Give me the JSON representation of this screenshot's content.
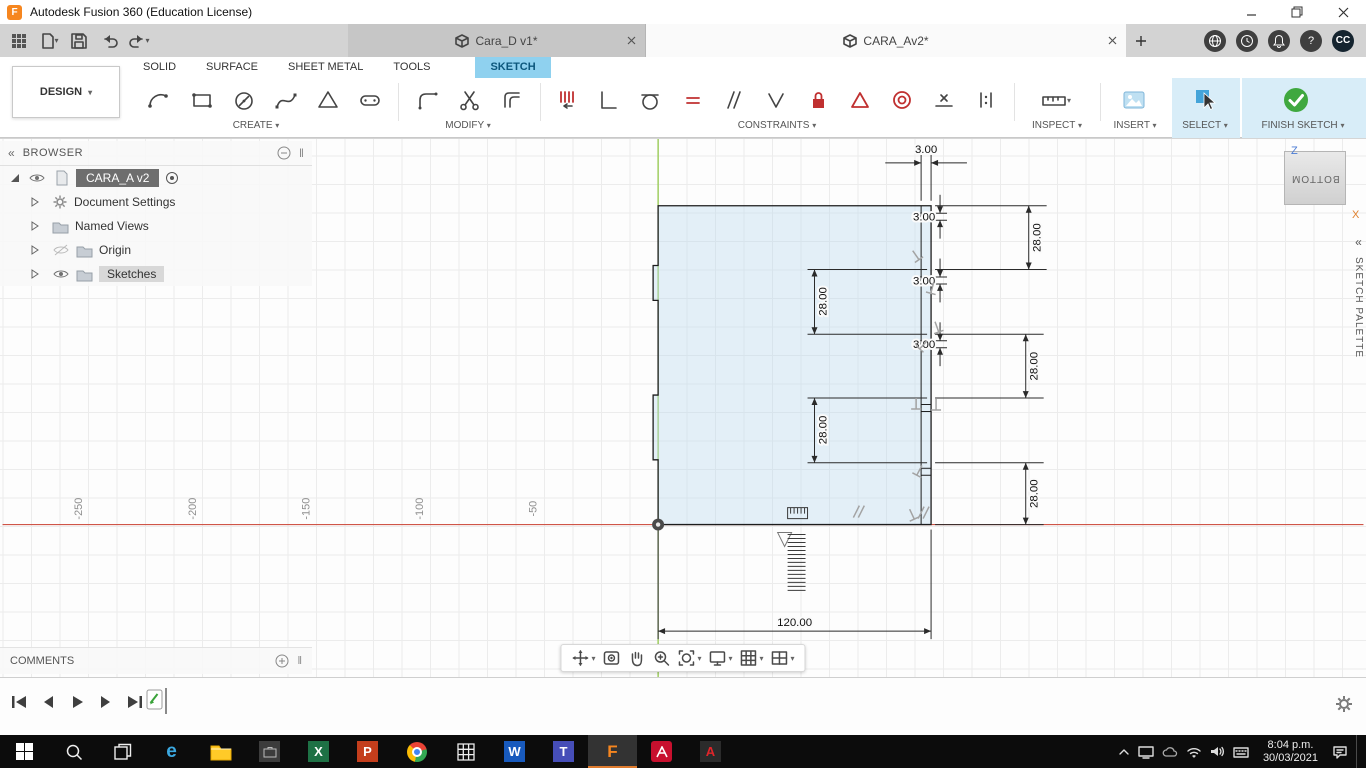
{
  "titlebar": {
    "title": "Autodesk Fusion 360 (Education License)"
  },
  "tabbar": {
    "doc_tabs": [
      {
        "label": "Cara_D v1*"
      },
      {
        "label": "CARA_Av2*"
      }
    ],
    "avatar": "CC"
  },
  "glyphs": {
    "fusion": "F",
    "help": "?",
    "edge": "e",
    "excel": "X",
    "powerpoint": "P",
    "word": "W",
    "teams": "T",
    "acrobat": "A"
  },
  "ribbon": {
    "design_label": "DESIGN",
    "tabs": [
      {
        "label": "SOLID"
      },
      {
        "label": "SURFACE"
      },
      {
        "label": "SHEET METAL"
      },
      {
        "label": "TOOLS"
      },
      {
        "label": "SKETCH"
      }
    ],
    "active_tab": "SKETCH",
    "groups": [
      {
        "label": "CREATE"
      },
      {
        "label": "MODIFY"
      },
      {
        "label": "CONSTRAINTS"
      },
      {
        "label": "INSPECT"
      },
      {
        "label": "INSERT"
      },
      {
        "label": "SELECT"
      },
      {
        "label": "FINISH SKETCH"
      }
    ]
  },
  "browser": {
    "header": "BROWSER",
    "root_label": "CARA_A v2",
    "items": [
      {
        "label": "Document Settings"
      },
      {
        "label": "Named Views"
      },
      {
        "label": "Origin"
      },
      {
        "label": "Sketches"
      }
    ]
  },
  "comments": {
    "label": "COMMENTS"
  },
  "sketch_palette": {
    "label": "SKETCH PALETTE"
  },
  "viewcube": {
    "face": "BOTTOM",
    "z": "Z",
    "x": "X"
  },
  "canvas": {
    "ruler_labels": [
      {
        "v": "-250"
      },
      {
        "v": "-200"
      },
      {
        "v": "-150"
      },
      {
        "v": "-100"
      },
      {
        "v": "-50"
      }
    ],
    "dimensions": {
      "slot_widths": [
        {
          "v": "3.00"
        },
        {
          "v": "3.00"
        },
        {
          "v": "3.00"
        },
        {
          "v": "3.00"
        }
      ],
      "spacings": [
        {
          "v": "28.00"
        },
        {
          "v": "28.00"
        },
        {
          "v": "28.00"
        },
        {
          "v": "28.00"
        },
        {
          "v": "28.00"
        }
      ],
      "overall_width": "120.00"
    }
  },
  "taskbar": {
    "time": "8:04 p.m.",
    "date": "30/03/2021"
  },
  "colors": {
    "accent_blue": "#0696d7",
    "sketch_fill": "#bcd9ee",
    "axis_x_red": "#cf5548",
    "axis_y_green": "#8cc63e",
    "finish_green": "#3fa83f",
    "fusion_orange": "#f6861f"
  }
}
